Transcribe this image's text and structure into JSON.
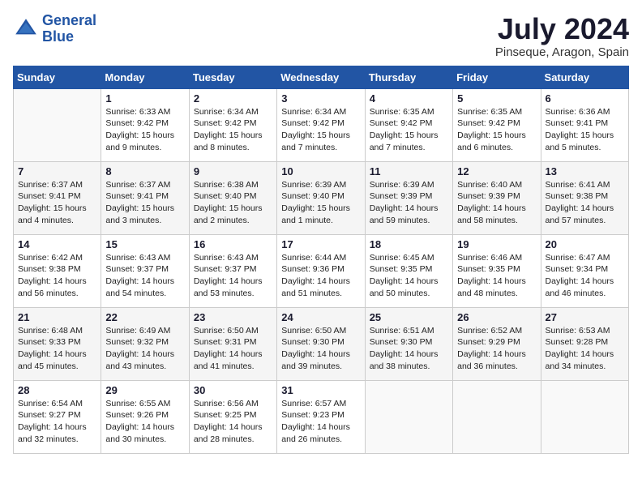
{
  "header": {
    "logo_line1": "General",
    "logo_line2": "Blue",
    "month_year": "July 2024",
    "location": "Pinseque, Aragon, Spain"
  },
  "days_of_week": [
    "Sunday",
    "Monday",
    "Tuesday",
    "Wednesday",
    "Thursday",
    "Friday",
    "Saturday"
  ],
  "weeks": [
    [
      {
        "day": "",
        "info": ""
      },
      {
        "day": "1",
        "info": "Sunrise: 6:33 AM\nSunset: 9:42 PM\nDaylight: 15 hours\nand 9 minutes."
      },
      {
        "day": "2",
        "info": "Sunrise: 6:34 AM\nSunset: 9:42 PM\nDaylight: 15 hours\nand 8 minutes."
      },
      {
        "day": "3",
        "info": "Sunrise: 6:34 AM\nSunset: 9:42 PM\nDaylight: 15 hours\nand 7 minutes."
      },
      {
        "day": "4",
        "info": "Sunrise: 6:35 AM\nSunset: 9:42 PM\nDaylight: 15 hours\nand 7 minutes."
      },
      {
        "day": "5",
        "info": "Sunrise: 6:35 AM\nSunset: 9:42 PM\nDaylight: 15 hours\nand 6 minutes."
      },
      {
        "day": "6",
        "info": "Sunrise: 6:36 AM\nSunset: 9:41 PM\nDaylight: 15 hours\nand 5 minutes."
      }
    ],
    [
      {
        "day": "7",
        "info": "Sunrise: 6:37 AM\nSunset: 9:41 PM\nDaylight: 15 hours\nand 4 minutes."
      },
      {
        "day": "8",
        "info": "Sunrise: 6:37 AM\nSunset: 9:41 PM\nDaylight: 15 hours\nand 3 minutes."
      },
      {
        "day": "9",
        "info": "Sunrise: 6:38 AM\nSunset: 9:40 PM\nDaylight: 15 hours\nand 2 minutes."
      },
      {
        "day": "10",
        "info": "Sunrise: 6:39 AM\nSunset: 9:40 PM\nDaylight: 15 hours\nand 1 minute."
      },
      {
        "day": "11",
        "info": "Sunrise: 6:39 AM\nSunset: 9:39 PM\nDaylight: 14 hours\nand 59 minutes."
      },
      {
        "day": "12",
        "info": "Sunrise: 6:40 AM\nSunset: 9:39 PM\nDaylight: 14 hours\nand 58 minutes."
      },
      {
        "day": "13",
        "info": "Sunrise: 6:41 AM\nSunset: 9:38 PM\nDaylight: 14 hours\nand 57 minutes."
      }
    ],
    [
      {
        "day": "14",
        "info": "Sunrise: 6:42 AM\nSunset: 9:38 PM\nDaylight: 14 hours\nand 56 minutes."
      },
      {
        "day": "15",
        "info": "Sunrise: 6:43 AM\nSunset: 9:37 PM\nDaylight: 14 hours\nand 54 minutes."
      },
      {
        "day": "16",
        "info": "Sunrise: 6:43 AM\nSunset: 9:37 PM\nDaylight: 14 hours\nand 53 minutes."
      },
      {
        "day": "17",
        "info": "Sunrise: 6:44 AM\nSunset: 9:36 PM\nDaylight: 14 hours\nand 51 minutes."
      },
      {
        "day": "18",
        "info": "Sunrise: 6:45 AM\nSunset: 9:35 PM\nDaylight: 14 hours\nand 50 minutes."
      },
      {
        "day": "19",
        "info": "Sunrise: 6:46 AM\nSunset: 9:35 PM\nDaylight: 14 hours\nand 48 minutes."
      },
      {
        "day": "20",
        "info": "Sunrise: 6:47 AM\nSunset: 9:34 PM\nDaylight: 14 hours\nand 46 minutes."
      }
    ],
    [
      {
        "day": "21",
        "info": "Sunrise: 6:48 AM\nSunset: 9:33 PM\nDaylight: 14 hours\nand 45 minutes."
      },
      {
        "day": "22",
        "info": "Sunrise: 6:49 AM\nSunset: 9:32 PM\nDaylight: 14 hours\nand 43 minutes."
      },
      {
        "day": "23",
        "info": "Sunrise: 6:50 AM\nSunset: 9:31 PM\nDaylight: 14 hours\nand 41 minutes."
      },
      {
        "day": "24",
        "info": "Sunrise: 6:50 AM\nSunset: 9:30 PM\nDaylight: 14 hours\nand 39 minutes."
      },
      {
        "day": "25",
        "info": "Sunrise: 6:51 AM\nSunset: 9:30 PM\nDaylight: 14 hours\nand 38 minutes."
      },
      {
        "day": "26",
        "info": "Sunrise: 6:52 AM\nSunset: 9:29 PM\nDaylight: 14 hours\nand 36 minutes."
      },
      {
        "day": "27",
        "info": "Sunrise: 6:53 AM\nSunset: 9:28 PM\nDaylight: 14 hours\nand 34 minutes."
      }
    ],
    [
      {
        "day": "28",
        "info": "Sunrise: 6:54 AM\nSunset: 9:27 PM\nDaylight: 14 hours\nand 32 minutes."
      },
      {
        "day": "29",
        "info": "Sunrise: 6:55 AM\nSunset: 9:26 PM\nDaylight: 14 hours\nand 30 minutes."
      },
      {
        "day": "30",
        "info": "Sunrise: 6:56 AM\nSunset: 9:25 PM\nDaylight: 14 hours\nand 28 minutes."
      },
      {
        "day": "31",
        "info": "Sunrise: 6:57 AM\nSunset: 9:23 PM\nDaylight: 14 hours\nand 26 minutes."
      },
      {
        "day": "",
        "info": ""
      },
      {
        "day": "",
        "info": ""
      },
      {
        "day": "",
        "info": ""
      }
    ]
  ]
}
